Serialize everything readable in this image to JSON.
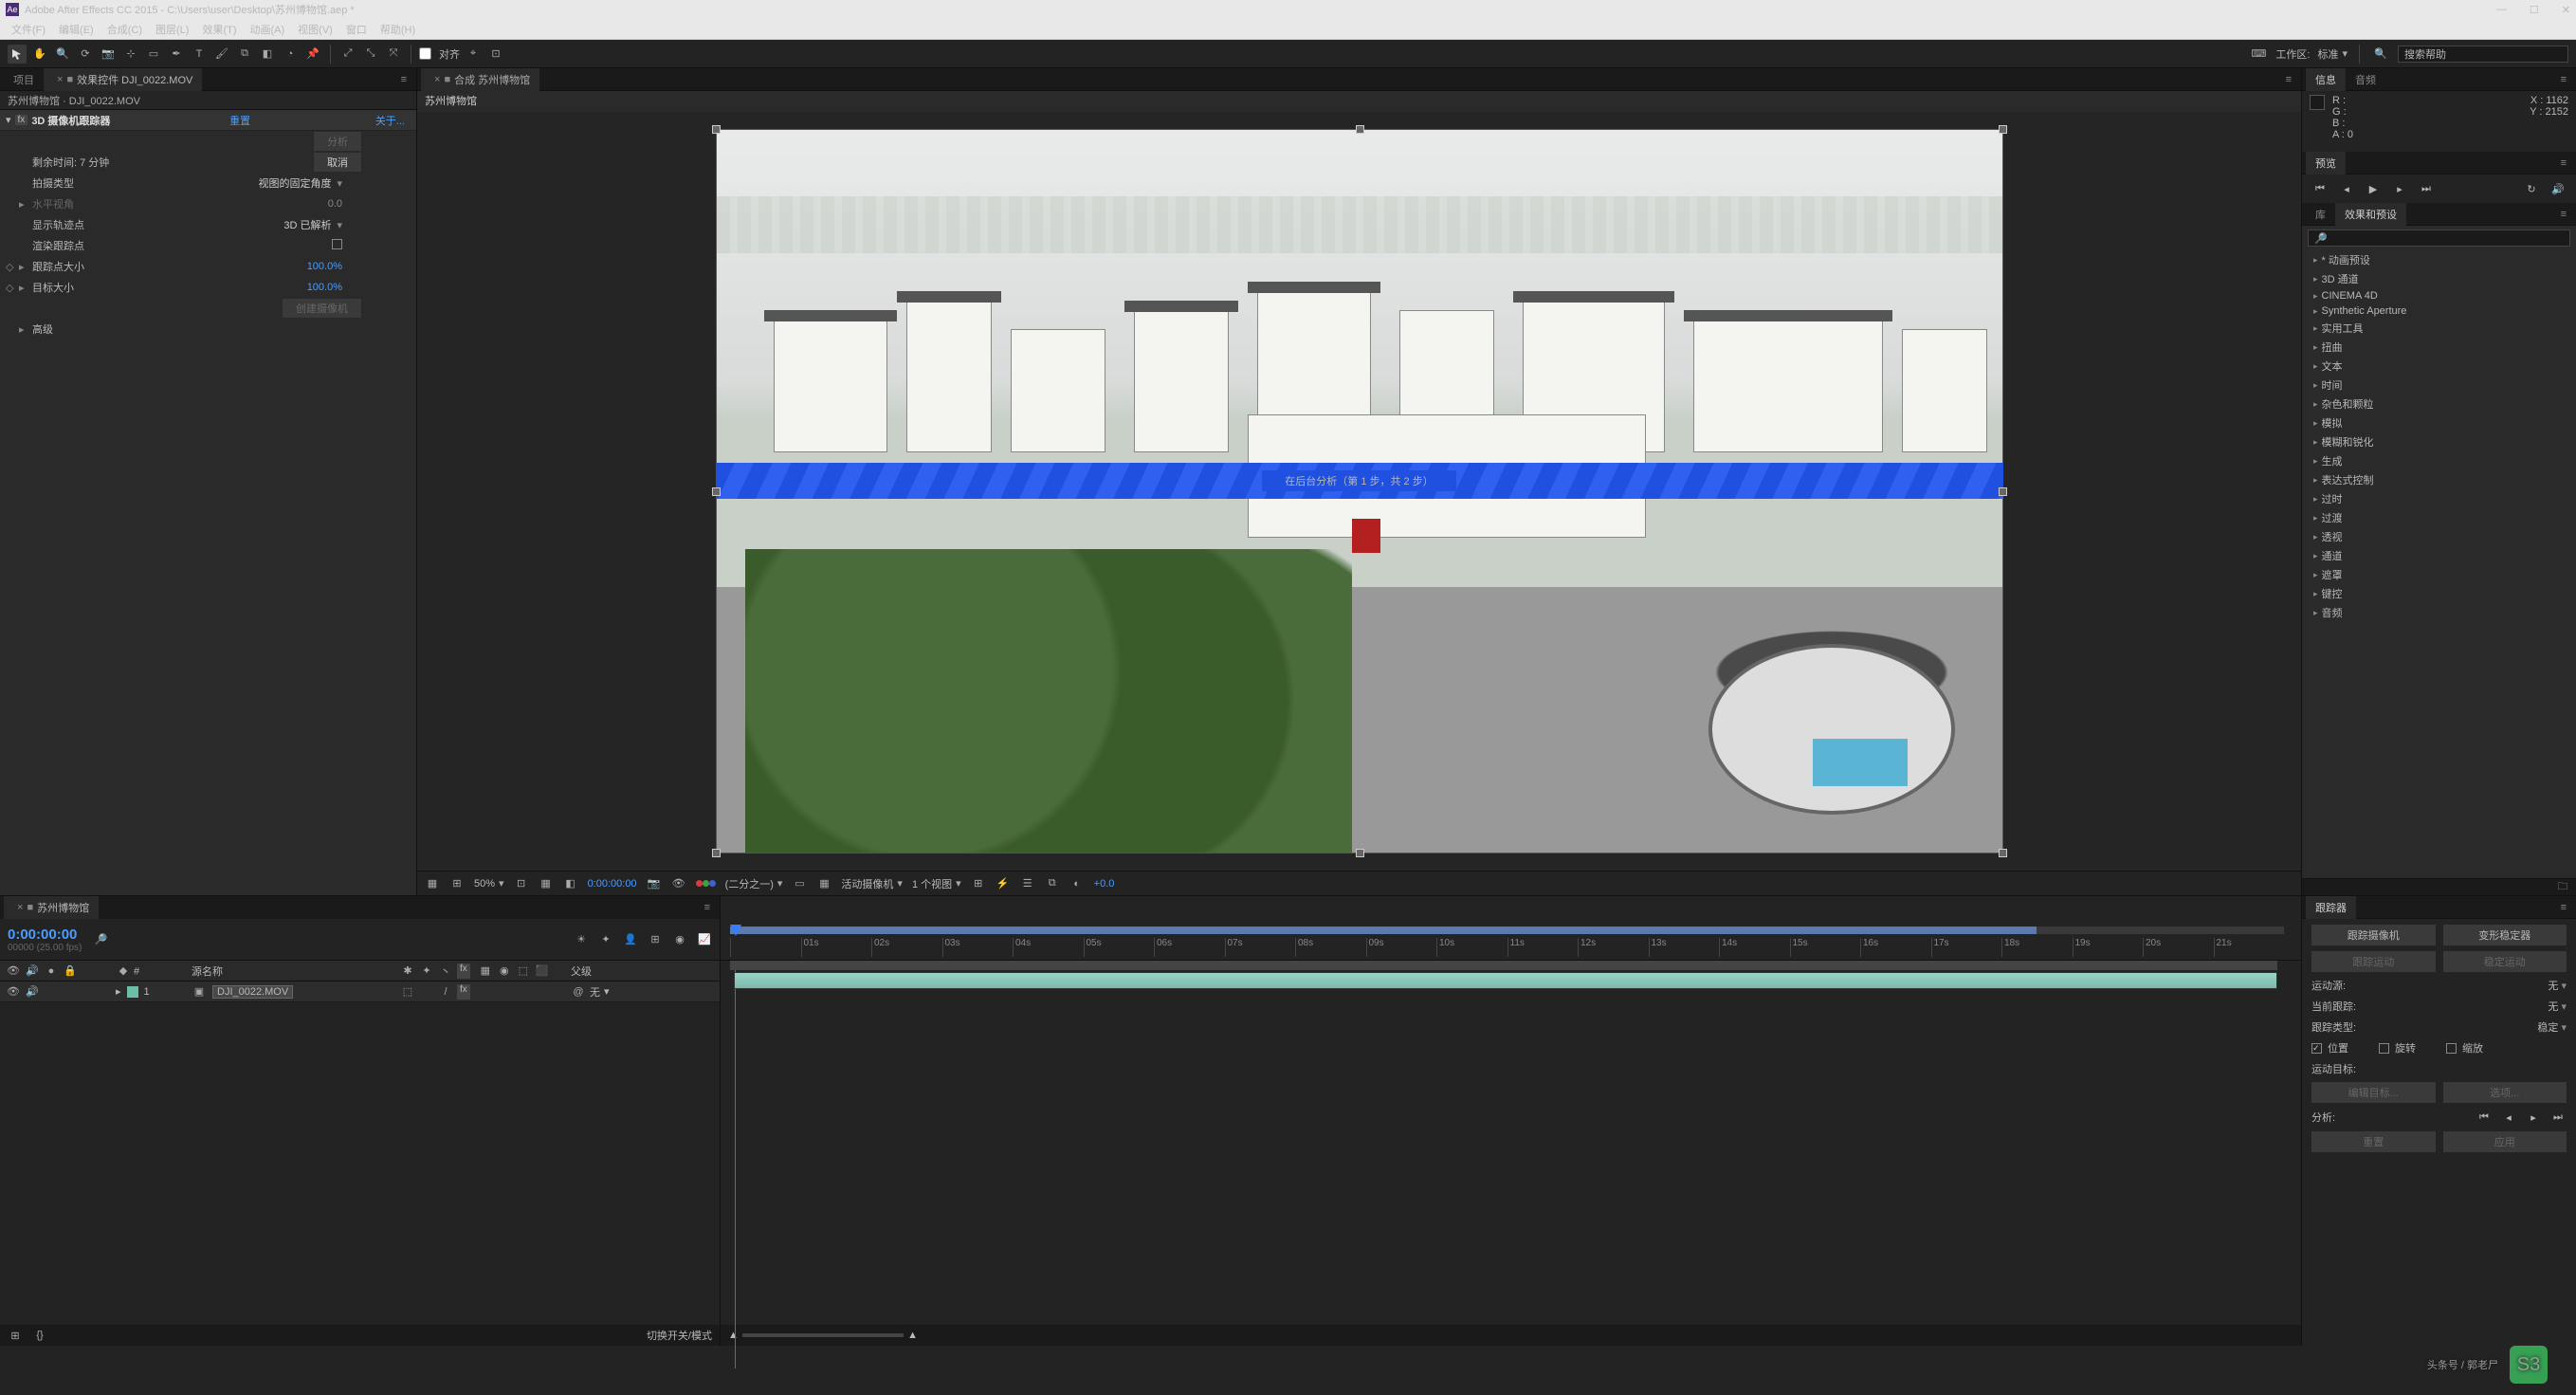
{
  "title": "Adobe After Effects CC 2015 - C:\\Users\\user\\Desktop\\苏州博物馆.aep *",
  "menu": [
    "文件(F)",
    "编辑(E)",
    "合成(C)",
    "图层(L)",
    "效果(T)",
    "动画(A)",
    "视图(V)",
    "窗口",
    "帮助(H)"
  ],
  "toolbar": {
    "align_label": "对齐",
    "workspace_label": "工作区:",
    "workspace_value": "标准",
    "search_placeholder": "搜索帮助"
  },
  "projectPanel": {
    "tab_project": "项目",
    "tab_effect": "效果控件 DJI_0022.MOV",
    "menu_icon": "≡"
  },
  "breadcrumb": "苏州博物馆 · DJI_0022.MOV",
  "effect": {
    "name": "3D 摄像机跟踪器",
    "reset": "重置",
    "about": "关于...",
    "analyze": "分析",
    "cancel": "取消",
    "remaining_label": "剩余时间: 7 分钟",
    "shot_type_label": "拍摄类型",
    "shot_type_value": "视图的固定角度",
    "hfov_label": "水平视角",
    "hfov_value": "0.0",
    "show_tracks_label": "显示轨迹点",
    "show_tracks_value": "3D 已解析",
    "render_tracks_label": "渲染跟踪点",
    "track_size_label": "跟踪点大小",
    "track_size_value": "100.0%",
    "target_size_label": "目标大小",
    "target_size_value": "100.0%",
    "create_camera": "创建摄像机",
    "advanced": "高级"
  },
  "compPanel": {
    "tab_comp": "合成 苏州博物馆",
    "tab_sub": "苏州博物馆",
    "banner_text": "在后台分析（第 1 步，共 2 步）"
  },
  "compFooter": {
    "zoom": "50%",
    "timecode": "0:00:00:00",
    "quality": "(二分之一)",
    "camera": "活动摄像机",
    "views": "1 个视图",
    "exposure": "+0.0"
  },
  "infoPanel": {
    "tab_info": "信息",
    "tab_audio": "音频",
    "R": "R :",
    "G": "G :",
    "B": "B :",
    "A": "A : 0",
    "X": "X : 1162",
    "Y": "Y : 2152"
  },
  "previewPanel": {
    "tab": "预览"
  },
  "effectsPresets": {
    "tab_lib": "库",
    "tab_fx": "效果和预设",
    "search": "",
    "cats": [
      "* 动画预设",
      "3D 通道",
      "CINEMA 4D",
      "Synthetic Aperture",
      "实用工具",
      "扭曲",
      "文本",
      "时间",
      "杂色和颗粒",
      "模拟",
      "模糊和锐化",
      "生成",
      "表达式控制",
      "过时",
      "过渡",
      "透视",
      "通道",
      "遮罩",
      "键控",
      "音频"
    ]
  },
  "timeline": {
    "tab": "苏州博物馆",
    "timecode": "0:00:00:00",
    "fps": "00000 (25.00 fps)",
    "col_source": "源名称",
    "col_parent": "父级",
    "layer_num": "1",
    "layer_name": "DJI_0022.MOV",
    "parent_value": "无",
    "footer_toggle": "切换开关/模式",
    "ticks": [
      "01s",
      "02s",
      "03s",
      "04s",
      "05s",
      "06s",
      "07s",
      "08s",
      "09s",
      "10s",
      "11s",
      "12s",
      "13s",
      "14s",
      "15s",
      "16s",
      "17s",
      "18s",
      "19s",
      "20s",
      "21s"
    ]
  },
  "tracker": {
    "tab": "跟踪器",
    "track_cam": "跟踪摄像机",
    "warp_stab": "变形稳定器",
    "track_motion": "跟踪运动",
    "stabilize": "稳定运动",
    "motion_src_label": "运动源:",
    "motion_src_value": "无",
    "current_track_label": "当前跟踪:",
    "current_track_value": "无",
    "track_type_label": "跟踪类型:",
    "track_type_value": "稳定",
    "position": "位置",
    "rotation": "旋转",
    "scale": "缩放",
    "motion_target": "运动目标:",
    "edit_target": "编辑目标...",
    "options": "选项...",
    "analyze_label": "分析:",
    "reset": "重置",
    "apply": "应用"
  },
  "watermark": "头条号 / 郭老尸"
}
